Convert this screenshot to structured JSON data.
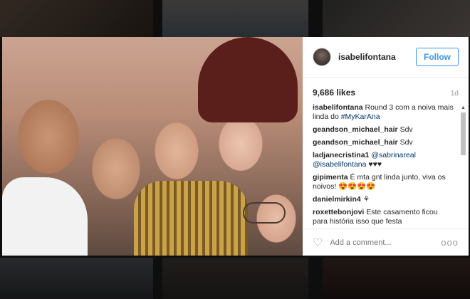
{
  "post": {
    "username": "isabelifontana",
    "follow_label": "Follow",
    "likes": "9,686 likes",
    "age": "1d"
  },
  "comments": [
    {
      "user": "isabelifontana",
      "text": "Round 3 com a noiva mais linda do ",
      "tag": "#MyKarAna"
    },
    {
      "user": "geandson_michael_hair",
      "text": "Sdv",
      "tag": ""
    },
    {
      "user": "geandson_michael_hair",
      "text": "Sdv",
      "tag": ""
    },
    {
      "user": "ladjanecristina1",
      "text": "",
      "tag": "@sabrinareal @isabelifontana",
      "suffix": "♥♥♥"
    },
    {
      "user": "gipimenta",
      "text": "É mta gnt linda junto, viva os noivos! 😍😍😍😍",
      "tag": ""
    },
    {
      "user": "danielmirkin4",
      "text": "⚘",
      "tag": ""
    },
    {
      "user": "roxettebonjovi",
      "text": "Este casamento ficou para história isso que festa",
      "tag": ""
    }
  ],
  "footer": {
    "placeholder": "Add a comment...",
    "more": "ooo"
  },
  "icons": {
    "like": "heart-icon",
    "options": "more-options-icon",
    "avatar": "avatar"
  },
  "colors": {
    "accent": "#3897f0",
    "link": "#003569"
  }
}
